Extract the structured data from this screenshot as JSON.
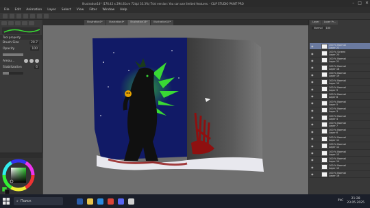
{
  "window": {
    "title": "Illustration14* (176.42 x 294.81cm 72dpi 33.3%)  Trial version: You can use limited features. - CLIP STUDIO PAINT PRO",
    "controls": [
      "–",
      "□",
      "✕"
    ]
  },
  "menu": [
    "File",
    "Edit",
    "Animation",
    "Layer",
    "Select",
    "View",
    "Filter",
    "Window",
    "Help"
  ],
  "tool_property": {
    "header": "Tool property",
    "brush_size_label": "Brush Size",
    "brush_size_value": "20.7",
    "opacity_label": "Opacity",
    "opacity_value": "100",
    "opacity_fraction": 1.0,
    "amount_label": "Amou...",
    "stabilization_label": "Stabilization",
    "stabilization_value": "6",
    "stabilization_fraction": 0.3
  },
  "document_tabs": [
    "Illustration1*",
    "Illustration4*",
    "Illustration14*",
    "Illustration14*"
  ],
  "layer_panel": {
    "tabs": [
      "Layer",
      "Layer Pr..."
    ],
    "blend_mode": "Normal",
    "opacity": "100",
    "layers": [
      {
        "mode": "100 % Normal",
        "name": "Layer 22",
        "selected": true
      },
      {
        "mode": "100 % Screen",
        "name": "Layer 20"
      },
      {
        "mode": "100 % Normal",
        "name": "Layer 21"
      },
      {
        "mode": "100 % Normal",
        "name": "Layer 18"
      },
      {
        "mode": "100 % Normal",
        "name": "Layer 19"
      },
      {
        "mode": "100 % Normal",
        "name": "Layer 10"
      },
      {
        "mode": "100 % Normal",
        "name": "Layer 9"
      },
      {
        "mode": "100 % Normal",
        "name": "Layer 8"
      },
      {
        "mode": "100 % Normal",
        "name": "Layer 5"
      },
      {
        "mode": "100 % Normal",
        "name": "Layer 3"
      },
      {
        "mode": "100 % Normal",
        "name": "Layer 4"
      },
      {
        "mode": "100 % Normal",
        "name": "Layer 7"
      },
      {
        "mode": "100 % Normal",
        "name": "Layer 6"
      },
      {
        "mode": "100 % Normal",
        "name": "Layer 11"
      },
      {
        "mode": "100 % Normal",
        "name": "Layer 12"
      },
      {
        "mode": "100 % Normal",
        "name": "Layer 13"
      },
      {
        "mode": "100 % Normal",
        "name": "Layer 14"
      },
      {
        "mode": "100 % Normal",
        "name": "Layer 15"
      },
      {
        "mode": "100 % Normal",
        "name": "Layer 16"
      }
    ]
  },
  "taskbar": {
    "search_placeholder": "Поиск",
    "language": "РУС",
    "time": "21:28",
    "date": "23.05.2025"
  },
  "colors": {
    "canvas_bg": "#6f6f6f",
    "night_blue": "#111a66",
    "accent_green": "#39d934",
    "blood_red": "#8e1010",
    "selected_layer": "#6a7aa0"
  }
}
